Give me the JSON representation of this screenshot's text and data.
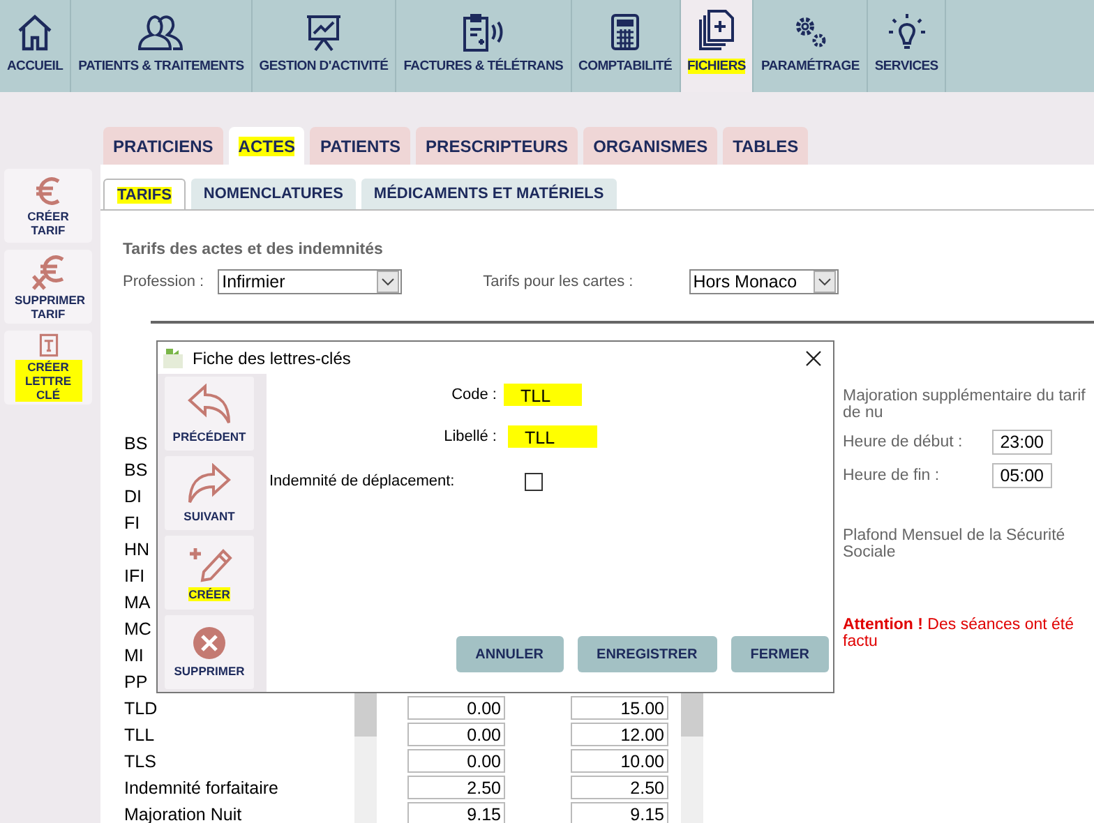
{
  "nav": [
    {
      "label": "ACCUEIL",
      "selected": false,
      "highlighted": false
    },
    {
      "label": "PATIENTS & TRAITEMENTS",
      "selected": false,
      "highlighted": false
    },
    {
      "label": "GESTION D'ACTIVITÉ",
      "selected": false,
      "highlighted": false
    },
    {
      "label": "FACTURES & TÉLÉTRANS",
      "selected": false,
      "highlighted": false
    },
    {
      "label": "COMPTABILITÉ",
      "selected": false,
      "highlighted": false
    },
    {
      "label": "FICHIERS",
      "selected": true,
      "highlighted": true
    },
    {
      "label": "PARAMÉTRAGE",
      "selected": false,
      "highlighted": false
    },
    {
      "label": "SERVICES",
      "selected": false,
      "highlighted": false
    }
  ],
  "sidebar": [
    {
      "label": "CRÉER TARIF",
      "highlighted": false
    },
    {
      "label": "SUPPRIMER TARIF",
      "highlighted": false
    },
    {
      "label": "CRÉER LETTRE CLÉ",
      "highlighted": true
    }
  ],
  "tabs": [
    {
      "label": "PRATICIENS",
      "selected": false,
      "highlighted": false
    },
    {
      "label": "ACTES",
      "selected": true,
      "highlighted": true
    },
    {
      "label": "PATIENTS",
      "selected": false,
      "highlighted": false
    },
    {
      "label": "PRESCRIPTEURS",
      "selected": false,
      "highlighted": false
    },
    {
      "label": "ORGANISMES",
      "selected": false,
      "highlighted": false
    },
    {
      "label": "TABLES",
      "selected": false,
      "highlighted": false
    }
  ],
  "subtabs": [
    {
      "label": "TARIFS",
      "selected": true,
      "highlighted": true
    },
    {
      "label": "NOMENCLATURES",
      "selected": false,
      "highlighted": false
    },
    {
      "label": "MÉDICAMENTS ET MATÉRIELS",
      "selected": false,
      "highlighted": false
    }
  ],
  "section_title": "Tarifs des actes et des indemnités",
  "profession": {
    "label": "Profession :",
    "value": "Infirmier"
  },
  "cards": {
    "label": "Tarifs pour les cartes :",
    "value": "Hors Monaco"
  },
  "table": {
    "rows": [
      {
        "label": "BS"
      },
      {
        "label": "BS"
      },
      {
        "label": "DI"
      },
      {
        "label": "FI"
      },
      {
        "label": "HN"
      },
      {
        "label": "IFI"
      },
      {
        "label": "MA"
      },
      {
        "label": "MC"
      },
      {
        "label": "MI"
      },
      {
        "label": "PP"
      },
      {
        "label": "TLD",
        "value_1": "0.00",
        "value_2": "15.00"
      },
      {
        "label": "TLL",
        "value_1": "0.00",
        "value_2": "12.00"
      },
      {
        "label": "TLS",
        "value_1": "0.00",
        "value_2": "10.00"
      },
      {
        "label": "Indemnité forfaitaire",
        "value_1": "2.50",
        "value_2": "2.50"
      },
      {
        "label": "Majoration Nuit",
        "value_1": "9.15",
        "value_2": "9.15"
      }
    ]
  },
  "night": {
    "title": "Majoration supplémentaire du tarif de nu",
    "start_label": "Heure de début :",
    "start": "23:00",
    "end_label": "Heure de fin :",
    "end": "05:00"
  },
  "ceiling": "Plafond Mensuel de la Sécurité Sociale",
  "warning": "**Attention !** Des séances ont été factu",
  "dialog": {
    "title": "Fiche des lettres-clés",
    "side_buttons": [
      {
        "label": "PRÉCÉDENT",
        "highlighted": false
      },
      {
        "label": "SUIVANT",
        "highlighted": false
      },
      {
        "label": "CRÉER",
        "highlighted": true
      },
      {
        "label": "SUPPRIMER",
        "highlighted": false
      }
    ],
    "code": {
      "label": "Code :",
      "value": "TLL",
      "highlighted": true
    },
    "libelle": {
      "label": "Libellé :",
      "value": "TLL",
      "highlighted": true
    },
    "travel": {
      "label": "Indemnité de déplacement:",
      "checked": false
    },
    "buttons": [
      "ANNULER",
      "ENREGISTRER",
      "FERMER"
    ]
  }
}
